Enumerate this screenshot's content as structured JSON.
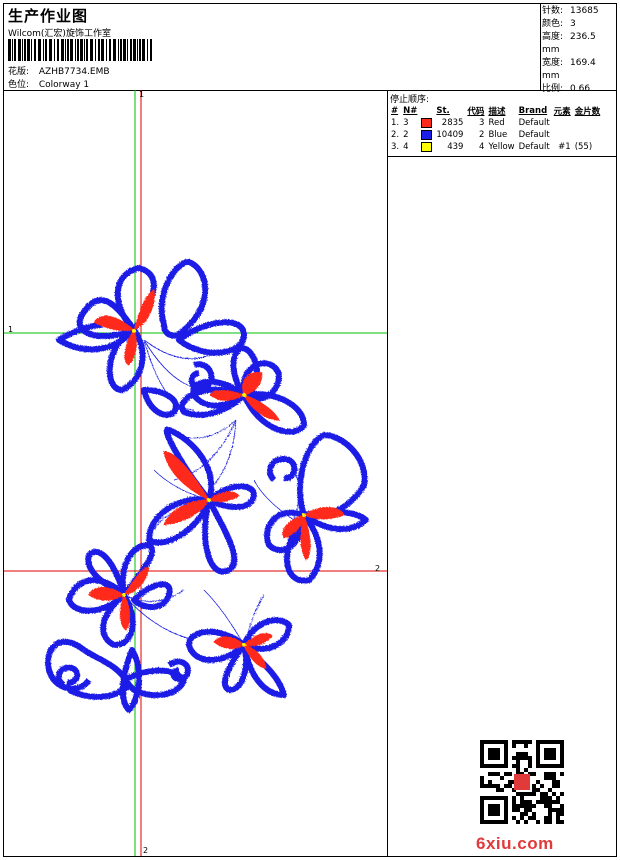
{
  "header": {
    "title": "生产作业图",
    "studio": "Wilcom(汇宏)旋饰工作室",
    "design_label": "花版:",
    "design_value": "AZHB7734.EMB",
    "colorway_label": "色位:",
    "colorway_value": "Colorway 1"
  },
  "stats": [
    {
      "label": "针数:",
      "value": "13685"
    },
    {
      "label": "颜色:",
      "value": "3"
    },
    {
      "label": "高度:",
      "value": "236.5 mm"
    },
    {
      "label": "宽度:",
      "value": "169.4 mm"
    },
    {
      "label": "比例:",
      "value": "0.66"
    }
  ],
  "sequence": {
    "label": "停止顺序:",
    "headers": [
      "#",
      "N#",
      "St.",
      "代码",
      "描述",
      "Brand",
      "元素",
      "金片数"
    ],
    "rows": [
      {
        "idx": "1.",
        "n": "3",
        "color": "#ff2a1a",
        "st": "2835",
        "code": "3",
        "desc": "Red",
        "brand": "Default",
        "elem": "",
        "sequin": ""
      },
      {
        "idx": "2.",
        "n": "2",
        "color": "#1a1ee6",
        "st": "10409",
        "code": "2",
        "desc": "Blue",
        "brand": "Default",
        "elem": "",
        "sequin": ""
      },
      {
        "idx": "3.",
        "n": "4",
        "color": "#ffff00",
        "st": "439",
        "code": "4",
        "desc": "Yellow",
        "brand": "Default",
        "elem": "#1",
        "sequin": "(55)"
      }
    ]
  },
  "guides": {
    "v1": "1",
    "h1": "1",
    "h2": "2",
    "v2": "2"
  },
  "colors": {
    "stitch_blue": "#1a1ee6",
    "stitch_red": "#ff2a1a",
    "guide_green": "#00c000",
    "guide_red": "#e00000"
  },
  "watermark": "6xiu.com"
}
